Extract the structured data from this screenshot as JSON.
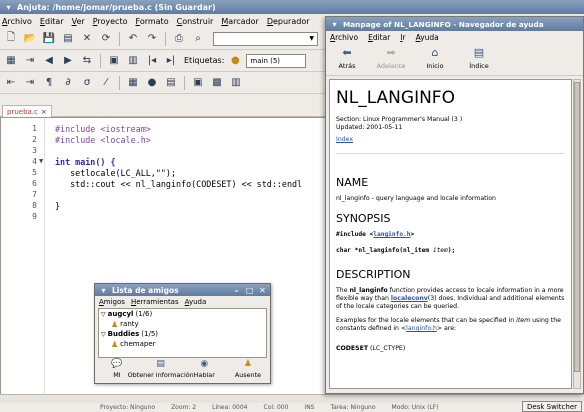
{
  "anjuta": {
    "title": "Anjuta: /home/jomar/prueba.c (Sin Guardar)",
    "menu": [
      "Archivo",
      "Editar",
      "Ver",
      "Proyecto",
      "Formato",
      "Construir",
      "Marcador",
      "Depurador"
    ],
    "tab_label": "prueba.c",
    "tab_close": "×",
    "bookmarks_label": "Etiquetas:",
    "function_combo": "main (5)",
    "code_lines": [
      {
        "n": "1",
        "text": "#include <iostream>"
      },
      {
        "n": "2",
        "text": "#include <locale.h>"
      },
      {
        "n": "3",
        "text": ""
      },
      {
        "n": "4",
        "text": "int main() {"
      },
      {
        "n": "5",
        "text": "   setlocale(LC_ALL,\"\");"
      },
      {
        "n": "6",
        "text": "   std::cout << nl_langinfo(CODESET) << std::endl"
      },
      {
        "n": "7",
        "text": ""
      },
      {
        "n": "8",
        "text": "}"
      },
      {
        "n": "9",
        "text": ""
      }
    ],
    "status": {
      "project": "Proyecto: Ninguno",
      "zoom": "Zoom: 2",
      "line": "Línea: 0004",
      "col": "Col: 000",
      "ins": "INS",
      "task": "Tarea: Ninguno",
      "mode": "Modo: Unix (LF)"
    },
    "desk_switcher": "Desk Switcher"
  },
  "help": {
    "title": "Manpage of NL_LANGINFO - Navegador de ayuda",
    "menu": [
      "Archivo",
      "Editar",
      "Ir",
      "Ayuda"
    ],
    "toolbar": [
      "Atrás",
      "Adelante",
      "Inicio",
      "Índice"
    ],
    "heading": "NL_LANGINFO",
    "section_line": "Section: Linux Programmer's Manual (3 )",
    "updated_line": "Updated: 2001-05-11",
    "index_link": "Index",
    "name_heading": "NAME",
    "name_text": "nl_langinfo - query language and locale information",
    "synopsis_heading": "SYNOPSIS",
    "synopsis_include_prefix": "#include <",
    "synopsis_include_link": "langinfo.h",
    "synopsis_include_suffix": ">",
    "synopsis_proto_prefix": "char *nl_langinfo(nl_item ",
    "synopsis_proto_arg": "item",
    "synopsis_proto_suffix": ");",
    "description_heading": "DESCRIPTION",
    "description_p1_a": "The ",
    "description_p1_b": "nl_langinfo",
    "description_p1_c": " function provides access to locale information in a more flexible way than ",
    "description_p1_link": "localeconv",
    "description_p1_d": "(3) does. Individual and additional elements of the locale categories can be queried.",
    "description_p2_a": "Examples for the locale elements that can be specified in ",
    "description_p2_item": "item",
    "description_p2_b": " using the constants defined in <",
    "description_p2_link": "langinfo.h",
    "description_p2_c": "> are:",
    "codeset_line_a": "CODESET",
    "codeset_line_b": " (LC_CTYPE)"
  },
  "buddy": {
    "title": "Lista de amigos",
    "menu": [
      "Amigos",
      "Herramientas",
      "Ayuda"
    ],
    "groups": [
      {
        "name": "augcyl",
        "count": "(1/6)",
        "members": [
          "ranty"
        ]
      },
      {
        "name": "Buddies",
        "count": "(1/5)",
        "members": [
          "chemaper"
        ]
      }
    ],
    "actions": [
      "MI",
      "Obtener información",
      "Hablar",
      "Ausente"
    ]
  }
}
